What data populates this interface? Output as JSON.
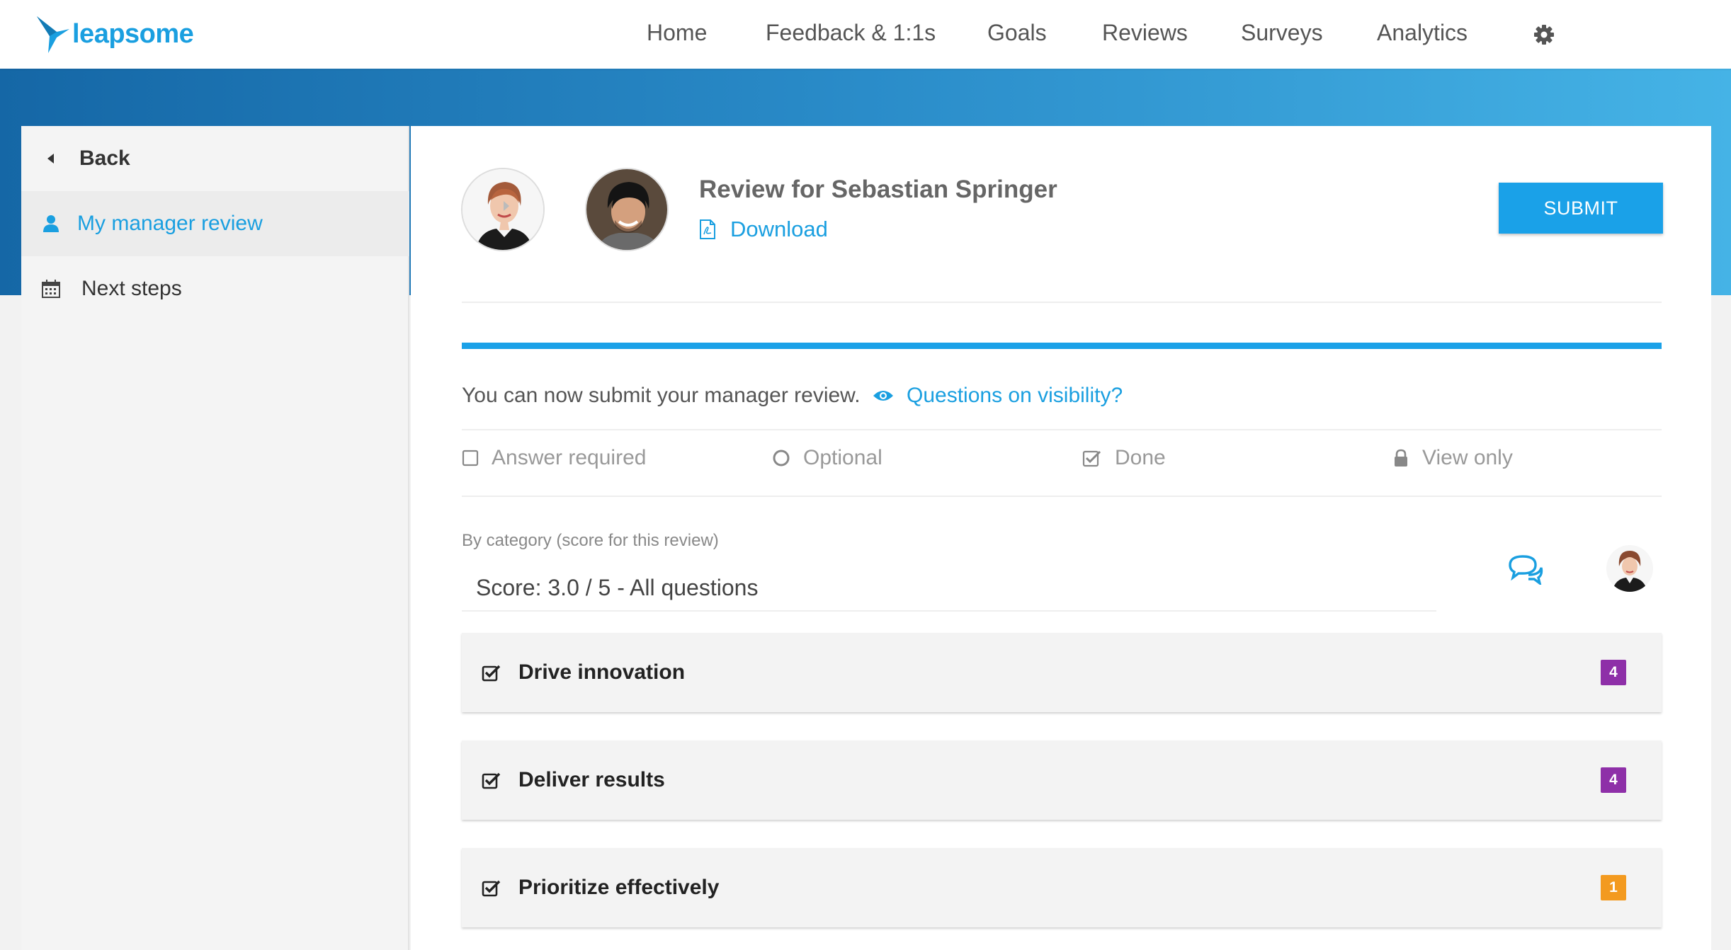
{
  "brand": {
    "name": "leapsome",
    "color": "#1a9fe0"
  },
  "nav": {
    "items": [
      {
        "label": "Home"
      },
      {
        "label": "Feedback & 1:1s"
      },
      {
        "label": "Goals"
      },
      {
        "label": "Reviews"
      },
      {
        "label": "Surveys"
      },
      {
        "label": "Analytics"
      }
    ],
    "settings_icon": "gear-icon"
  },
  "sidebar": {
    "back_label": "Back",
    "items": [
      {
        "label": "My manager review",
        "icon": "user-icon",
        "active": true
      },
      {
        "label": "Next steps",
        "icon": "calendar-icon",
        "active": false
      }
    ]
  },
  "review": {
    "title": "Review for Sebastian Springer",
    "download_label": "Download",
    "submit_label": "SUBMIT",
    "progress_fraction": 1.0,
    "info_text": "You can now submit your manager review.",
    "visibility_label": "Questions on visibility?"
  },
  "legend": [
    {
      "label": "Answer required",
      "icon": "empty-checkbox-icon"
    },
    {
      "label": "Optional",
      "icon": "circle-icon"
    },
    {
      "label": "Done",
      "icon": "checked-checkbox-icon"
    },
    {
      "label": "View only",
      "icon": "lock-icon"
    }
  ],
  "score_section": {
    "category_label": "By category (score for this review)",
    "score_text": "Score: 3.0 / 5 - All questions"
  },
  "categories": [
    {
      "name": "Drive innovation",
      "badge": "4",
      "badge_color": "#8e2fa8"
    },
    {
      "name": "Deliver results",
      "badge": "4",
      "badge_color": "#8e2fa8"
    },
    {
      "name": "Prioritize effectively",
      "badge": "1",
      "badge_color": "#f39a1f"
    }
  ]
}
